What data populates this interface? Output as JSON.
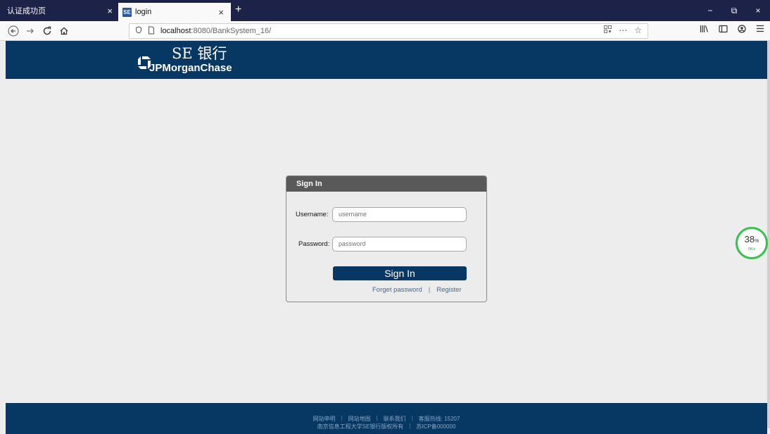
{
  "browser": {
    "tabs": [
      {
        "title": "认证成功页",
        "close": "×"
      },
      {
        "title": "login",
        "favicon": "SE",
        "close": "×"
      }
    ],
    "new_tab": "+",
    "window_controls": {
      "minimize": "−",
      "restore": "⧉",
      "close": "×"
    },
    "url": {
      "host": "localhost",
      "path": ":8080/BankSystem_16/"
    }
  },
  "header": {
    "bank_name": "SE 银行",
    "brand": "JPMorganChase"
  },
  "login": {
    "panel_title": "Sign In",
    "username_label": "Username:",
    "username_placeholder": "username",
    "password_label": "Password:",
    "password_placeholder": "password",
    "submit_label": "Sign In",
    "forgot_link": "Forget password",
    "link_separator": "|",
    "register_link": "Register"
  },
  "speed_widget": {
    "percent": "38",
    "unit": "%",
    "rate": "0K/s"
  },
  "footer": {
    "links": [
      "网站申明",
      "网站地图",
      "联系我们",
      "客服热线: 15207"
    ],
    "copyright": "南京信息工程大学SE银行版权所有",
    "icp": "苏ICP备000000",
    "separator": "|"
  },
  "colors": {
    "brand_navy": "#073763",
    "tabbar": "#1d2348",
    "panel_header": "#595959",
    "link": "#3d6a99"
  }
}
